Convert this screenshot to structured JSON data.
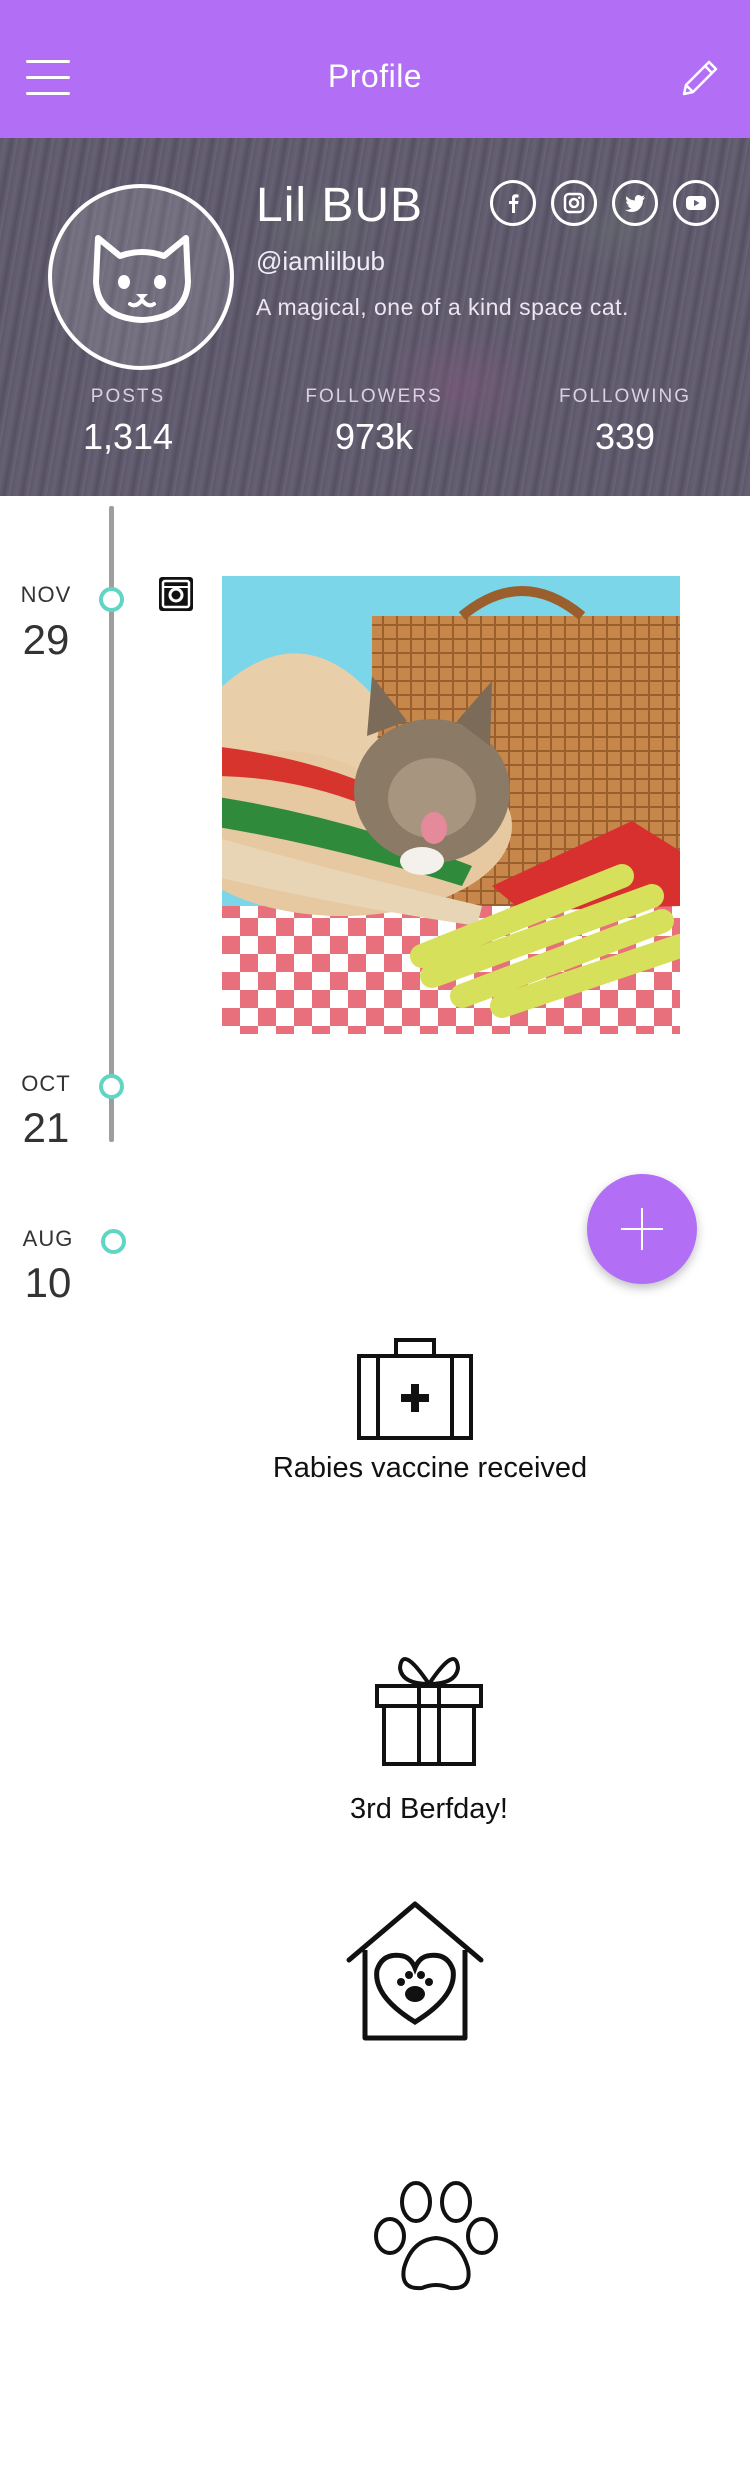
{
  "topbar": {
    "title": "Profile"
  },
  "profile": {
    "name": "Lil BUB",
    "handle": "@iamlilbub",
    "bio": "A magical, one of a kind space cat."
  },
  "stats": [
    {
      "label": "POSTS",
      "value": "1,314"
    },
    {
      "label": "FOLLOWERS",
      "value": "973k"
    },
    {
      "label": "FOLLOWING",
      "value": "339"
    }
  ],
  "social": [
    "facebook-icon",
    "instagram-icon",
    "twitter-icon",
    "youtube-icon"
  ],
  "timeline": [
    {
      "month": "NOV",
      "day": "29"
    },
    {
      "month": "OCT",
      "day": "21"
    },
    {
      "month": "AUG",
      "day": "10"
    }
  ],
  "events": {
    "vaccine": "Rabies vaccine received",
    "birthday": "3rd Berfday!"
  },
  "colors": {
    "accent": "#b26ef5",
    "timeline_node": "#5fd5c3",
    "timeline_line": "#9e9e9e"
  }
}
